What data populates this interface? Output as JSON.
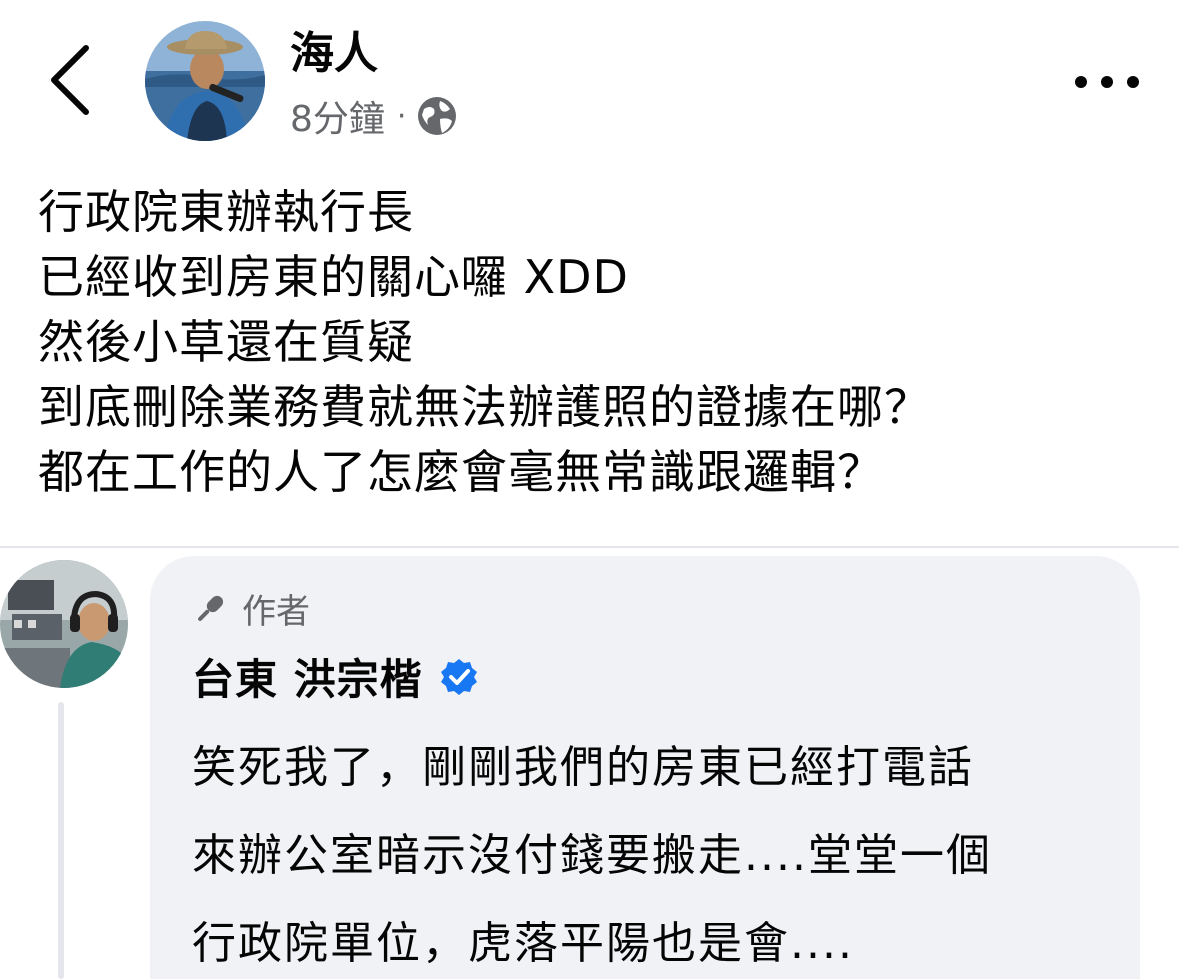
{
  "header": {
    "author_name": "海人",
    "time": "8分鐘",
    "separator": "·",
    "audience_icon": "globe-icon",
    "back_icon": "chevron-left-icon",
    "more_icon": "more-horizontal-icon"
  },
  "post": {
    "lines": [
      "行政院東辦執行長",
      "已經收到房東的關心囉 XDD",
      "然後小草還在質疑",
      "到底刪除業務費就無法辦護照的證據在哪？",
      "都在工作的人了怎麼會毫無常識跟邏輯？"
    ]
  },
  "comment": {
    "badge_label": "作者",
    "badge_icon": "microphone-icon",
    "name": "台東 洪宗楷",
    "verified_icon": "verified-badge-icon",
    "lines": [
      "笑死我了，剛剛我們的房東已經打電話",
      "來辦公室暗示沒付錢要搬走....堂堂一個",
      "行政院單位，虎落平陽也是會...."
    ]
  },
  "colors": {
    "text_primary": "#050505",
    "text_secondary": "#65676b",
    "bubble_bg": "#f0f2f5",
    "verified_blue": "#1877f2"
  }
}
